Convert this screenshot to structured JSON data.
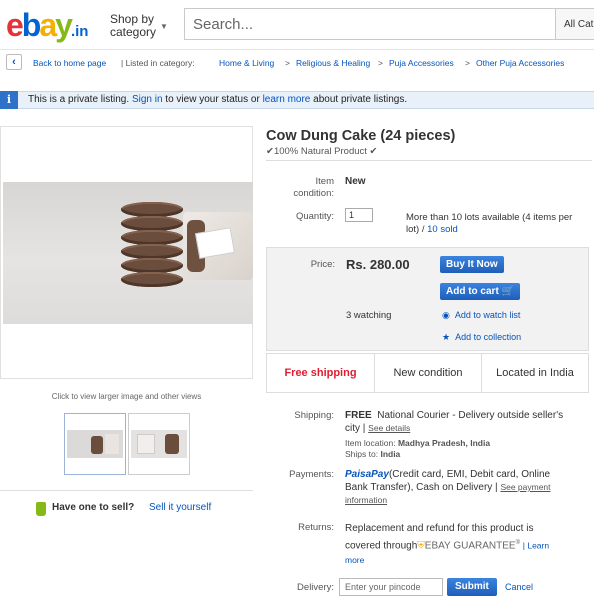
{
  "header": {
    "logo": {
      "e": "e",
      "b": "b",
      "a": "a",
      "y": "y",
      "suffix": ".in"
    },
    "shop_by_line1": "Shop by",
    "shop_by_line2": "category",
    "search_placeholder": "Search...",
    "all_categories": "All Cat"
  },
  "breadcrumb": {
    "back_label": "Back to home page",
    "listed_in": "| Listed in category:",
    "items": [
      "Home & Living",
      "Religious & Healing",
      "Puja Accessories",
      "Other Puja Accessories"
    ],
    "separator": ">"
  },
  "banner": {
    "icon": "i",
    "text_before": "This is a private listing.",
    "sign_in": "Sign in",
    "text_middle": "to view your status or",
    "learn_more": "learn more",
    "text_after": "about private listings."
  },
  "gallery": {
    "click_text": "Click to view larger image and other views"
  },
  "sell": {
    "question": "Have one to sell?",
    "link": "Sell it yourself"
  },
  "item": {
    "title": "Cow Dung Cake (24 pieces)",
    "subtitle": "✔100% Natural Product ✔",
    "condition_label_1": "Item",
    "condition_label_2": "condition:",
    "condition_value": "New",
    "quantity_label": "Quantity:",
    "quantity_value": "1",
    "availability": "More than 10 lots available (4 items per lot) /",
    "sold": "10 sold"
  },
  "price_box": {
    "label": "Price:",
    "price": "Rs. 280.00",
    "buy_now": "Buy It Now",
    "add_to_cart": "Add to cart",
    "watching": "3 watching",
    "add_watch": "Add to watch list",
    "add_collection": "Add to collection"
  },
  "info_bar": {
    "free_shipping": "Free shipping",
    "new_condition": "New condition",
    "located": "Located in India"
  },
  "shipping": {
    "label": "Shipping:",
    "free": "FREE",
    "courier": "National Courier - Delivery outside seller's",
    "city": "city |",
    "see_details": "See details",
    "item_location_label": "Item location:",
    "item_location": "Madhya Pradesh, India",
    "ships_to_label": "Ships to:",
    "ships_to": "India"
  },
  "payments": {
    "label": "Payments:",
    "paisapay": "PaisaPay",
    "line1": "(Credit card, EMI, Debit card, Online",
    "line2": "Bank Transfer),  Cash on Delivery  |",
    "see_payment": "See payment",
    "information": "information"
  },
  "returns": {
    "label": "Returns:",
    "line1": "Replacement and refund for this product is",
    "covered": "covered through",
    "guarantee": "EBAY GUARANTEE",
    "learn": "| Learn",
    "more": "more"
  },
  "delivery": {
    "label": "Delivery:",
    "placeholder": "Enter your pincode",
    "submit": "Submit",
    "cancel": "Cancel"
  },
  "colors": {
    "brand_red": "#e53238",
    "brand_blue": "#0064d2",
    "brand_yellow": "#f5af02",
    "brand_green": "#86b817",
    "link_blue": "#0654ba",
    "free_shipping_red": "#dd1e31"
  }
}
